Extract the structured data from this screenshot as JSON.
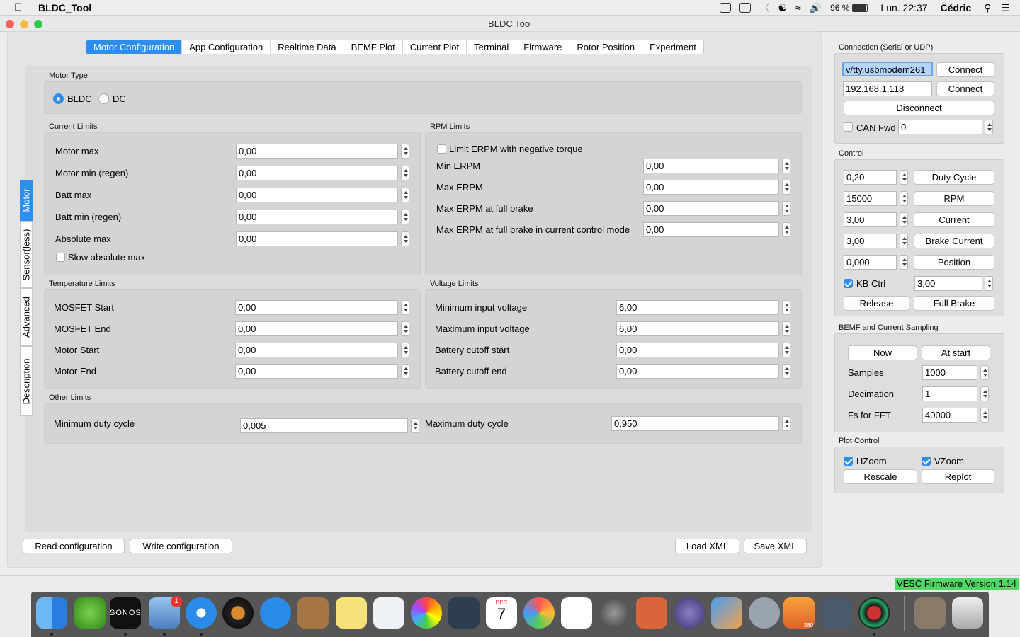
{
  "menubar": {
    "app_name": "BLDC_Tool",
    "battery": "96 %",
    "datetime": "Lun. 22:37",
    "user": "Cédric"
  },
  "window": {
    "title": "BLDC Tool"
  },
  "tabs": [
    "Motor Configuration",
    "App Configuration",
    "Realtime Data",
    "BEMF Plot",
    "Current Plot",
    "Terminal",
    "Firmware",
    "Rotor Position",
    "Experiment"
  ],
  "vtabs": [
    "Motor",
    "Sensor(less)",
    "Advanced",
    "Description"
  ],
  "motor_type": {
    "label": "Motor Type",
    "options": [
      "BLDC",
      "DC"
    ],
    "selected": "BLDC"
  },
  "current_limits": {
    "label": "Current Limits",
    "rows": [
      {
        "label": "Motor max",
        "value": "0,00"
      },
      {
        "label": "Motor min (regen)",
        "value": "0,00"
      },
      {
        "label": "Batt max",
        "value": "0,00"
      },
      {
        "label": "Batt min (regen)",
        "value": "0,00"
      },
      {
        "label": "Absolute max",
        "value": "0,00"
      }
    ],
    "slow_abs": "Slow absolute max"
  },
  "rpm_limits": {
    "label": "RPM Limits",
    "limit_neg": "Limit ERPM with negative torque",
    "rows": [
      {
        "label": "Min ERPM",
        "value": "0,00"
      },
      {
        "label": "Max ERPM",
        "value": "0,00"
      },
      {
        "label": "Max ERPM at full brake",
        "value": "0,00"
      },
      {
        "label": "Max ERPM at full brake in current control mode",
        "value": "0,00"
      }
    ]
  },
  "temp_limits": {
    "label": "Temperature Limits",
    "rows": [
      {
        "label": "MOSFET Start",
        "value": "0,00"
      },
      {
        "label": "MOSFET End",
        "value": "0,00"
      },
      {
        "label": "Motor Start",
        "value": "0,00"
      },
      {
        "label": "Motor End",
        "value": "0,00"
      }
    ]
  },
  "voltage_limits": {
    "label": "Voltage Limits",
    "rows": [
      {
        "label": "Minimum input voltage",
        "value": "6,00"
      },
      {
        "label": "Maximum input voltage",
        "value": "6,00"
      },
      {
        "label": "Battery cutoff start",
        "value": "0,00"
      },
      {
        "label": "Battery cutoff end",
        "value": "0,00"
      }
    ]
  },
  "other_limits": {
    "label": "Other Limits",
    "min_duty_label": "Minimum duty cycle",
    "min_duty": "0,005",
    "max_duty_label": "Maximum duty cycle",
    "max_duty": "0,950"
  },
  "bottom": {
    "read": "Read configuration",
    "write": "Write configuration",
    "load": "Load XML",
    "save": "Save XML"
  },
  "connection": {
    "label": "Connection (Serial or UDP)",
    "serial": "v/tty.usbmodem261",
    "udp": "192.168.1.118",
    "connect": "Connect",
    "disconnect": "Disconnect",
    "can_fwd": "CAN Fwd",
    "can_id": "0"
  },
  "control": {
    "label": "Control",
    "rows": [
      {
        "value": "0,20",
        "button": "Duty Cycle"
      },
      {
        "value": "15000",
        "button": "RPM"
      },
      {
        "value": "3,00",
        "button": "Current"
      },
      {
        "value": "3,00",
        "button": "Brake Current"
      },
      {
        "value": "0,000",
        "button": "Position"
      }
    ],
    "kb_ctrl": "KB Ctrl",
    "kb_value": "3,00",
    "release": "Release",
    "full_brake": "Full Brake"
  },
  "bemf": {
    "label": "BEMF and Current Sampling",
    "now": "Now",
    "at_start": "At start",
    "rows": [
      {
        "label": "Samples",
        "value": "1000"
      },
      {
        "label": "Decimation",
        "value": "1"
      },
      {
        "label": "Fs for FFT",
        "value": "40000"
      }
    ]
  },
  "plot_control": {
    "label": "Plot Control",
    "hzoom": "HZoom",
    "vzoom": "VZoom",
    "rescale": "Rescale",
    "replot": "Replot"
  },
  "status": {
    "firmware": "VESC Firmware Version 1.14"
  },
  "dock": {
    "sonos": "SONOS",
    "mail_badge": "1",
    "calendar_month": "DEC",
    "calendar_day": "7",
    "fusion_label": "360"
  },
  "colors": {
    "accent": "#2d8ef0",
    "firmware_bg": "#4cd964"
  }
}
